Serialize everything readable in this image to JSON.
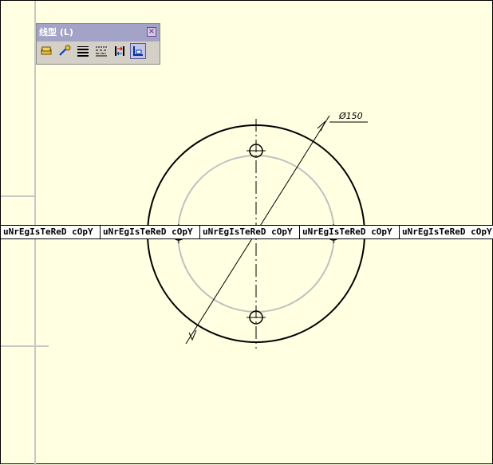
{
  "toolbar": {
    "title": "线型 (L)",
    "close_label": "×",
    "icons": [
      "layers-icon",
      "line-style-icon",
      "line-weight-icon",
      "line-pattern-icon",
      "swap-icon",
      "linetype-manager-icon"
    ]
  },
  "dimension": {
    "diameter_label": "Ø150"
  },
  "watermark": {
    "text": "uNrEgIsTeReD cOpY",
    "repeat": 5
  },
  "colors": {
    "background": "#ffffe1",
    "toolbar_title": "#a3a3c7",
    "grid": "#c8c8c8",
    "bolt_circle": "#c0c0c0"
  }
}
